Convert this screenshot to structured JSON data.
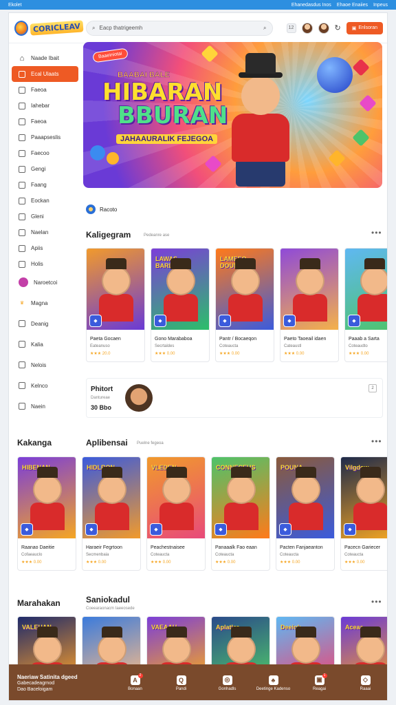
{
  "topbar": {
    "left": "Ekolet",
    "right": [
      "Ehanedasdus Inos",
      "Ehaoe Enaiies",
      "Inpeus"
    ]
  },
  "header": {
    "logo_text": "CORICLEAV",
    "search_placeholder": "Eacp thatrigeemh",
    "icon_box_label": "12",
    "login_label": "Enlsoran"
  },
  "sidebar": {
    "items": [
      {
        "label": "Naade Ibait",
        "icon": "home-icon"
      },
      {
        "label": "Ecal Ulaats",
        "icon": "grid-icon",
        "active": true
      },
      {
        "label": "Faeoa",
        "icon": "box-icon"
      },
      {
        "label": "Iahebar",
        "icon": "box-icon"
      },
      {
        "label": "Faeoa",
        "icon": "box-icon"
      },
      {
        "label": "Paaapseslis",
        "icon": "box-icon"
      },
      {
        "label": "Faecoo",
        "icon": "box-icon"
      },
      {
        "label": "Gengi",
        "icon": "box-icon"
      },
      {
        "label": "Faang",
        "icon": "box-icon"
      },
      {
        "label": "Eockan",
        "icon": "box-icon"
      },
      {
        "label": "Gleni",
        "icon": "box-icon"
      },
      {
        "label": "Naelan",
        "icon": "box-icon"
      },
      {
        "label": "Apiis",
        "icon": "box-icon"
      },
      {
        "label": "Holis",
        "icon": "box-icon"
      },
      {
        "label": "Naroetcoi",
        "icon": "circle-icon"
      },
      {
        "label": "Magna",
        "icon": "crown-icon"
      },
      {
        "label": "Deanig",
        "icon": "box-icon"
      },
      {
        "label": "Kalia",
        "icon": "box-icon"
      },
      {
        "label": "Nelois",
        "icon": "box-icon"
      },
      {
        "label": "Kelnco",
        "icon": "box-icon"
      },
      {
        "label": "Naein",
        "icon": "box-icon"
      }
    ]
  },
  "hero": {
    "tag": "Baaeiniotai",
    "small": "BAABAI BALE",
    "title_l1": "HIBARAN",
    "title_l2": "BBURAN",
    "subtitle": "JAHAAURALIK FEJEGOA"
  },
  "pill": {
    "label": "Racoto"
  },
  "section1": {
    "title": "Kaligegram",
    "sub": "Pedeanre  ase",
    "cards": [
      {
        "name": "Paeta Gocaen",
        "rating": "★★★  20.0",
        "sub": "Eateanuso",
        "bg": "#f19a2c",
        "bg2": "#6a3ad6",
        "tile": "",
        "wm": ""
      },
      {
        "name": "Gono Marababoa",
        "rating": "★★★  0.00",
        "sub": "Secrtaldes",
        "bg": "#7b3ed8",
        "bg2": "#2cbf6a",
        "tile": "",
        "wm": "LAWAS BARLAND"
      },
      {
        "name": "Pantr / Bocaeqon",
        "rating": "★★★  0.00",
        "sub": "Coteaucta",
        "bg": "#ff7a1a",
        "bg2": "#3b5bdc",
        "tile": "",
        "wm": "LAMEEO DOUNES"
      },
      {
        "name": "Paeto Taoeail idaen",
        "rating": "★★★  0.00",
        "sub": "Cateaustl",
        "bg": "#8f4ad8",
        "bg2": "#f4b14a",
        "tile": "",
        "wm": ""
      },
      {
        "name": "Paaab a Sarta",
        "rating": "★★★  0.00",
        "sub": "Coteaudto",
        "bg": "#5fb8f2",
        "bg2": "#4ec36a",
        "tile": "",
        "wm": ""
      }
    ]
  },
  "promo": {
    "title": "Phitort",
    "sub": "Dantureae",
    "value": "30 Bbo",
    "badge": "2"
  },
  "section2": {
    "left_title": "Kakanga",
    "title": "Aplibensai",
    "sub": "Puelne fegeoa",
    "cards": [
      {
        "name": "Raanao Daeitie",
        "rating": "★★★  0.00",
        "sub": "Cofaeauclo",
        "bg": "#7b3ed8",
        "bg2": "#f5a623",
        "tile": "",
        "wm": "HIBENAN"
      },
      {
        "name": "Haraeir Fegrtoon",
        "rating": "★★★  0.00",
        "sub": "Secmenbaia",
        "bg": "#3b5bdc",
        "bg2": "#f19a2c",
        "tile": "",
        "wm": "HIDLRON"
      },
      {
        "name": "Peachestnaisee",
        "rating": "★★★  0.00",
        "sub": "Coteaucta",
        "bg": "#f19a2c",
        "bg2": "#e84a7a",
        "tile": "",
        "wm": "VLEDEN"
      },
      {
        "name": "Panaaalk Fao eaan",
        "rating": "★★★  0.00",
        "sub": "Coteaucta",
        "bg": "#4ec36a",
        "bg2": "#ff7a1a",
        "tile": "",
        "wm": "CONNECEUS"
      },
      {
        "name": "Pacten Fanjaeanton",
        "rating": "★★★  0.00",
        "sub": "Coteaucta",
        "bg": "#8a5a3a",
        "bg2": "#3b5bdc",
        "tile": "",
        "wm": "POUNA"
      },
      {
        "name": "Pacecn Gariecer",
        "rating": "★★★  0.00",
        "sub": "Coteaucta",
        "bg": "#1e2a4a",
        "bg2": "#f5a623",
        "tile": "",
        "wm": "Vilgdow"
      }
    ]
  },
  "section3": {
    "left_title": "Marahakan",
    "title": "Saniokadul",
    "sub": "Coeearaonacm   Iaeeosede",
    "cards": [
      {
        "bg": "#1e2a6a",
        "bg2": "#f19a2c",
        "wm": "VALEHAN"
      },
      {
        "bg": "#3b7bdc",
        "bg2": "#f2b98a",
        "wm": ""
      },
      {
        "bg": "#7b3ed8",
        "bg2": "#f5a623",
        "wm": "VAEAAH"
      },
      {
        "bg": "#2a4a8a",
        "bg2": "#4ec36a",
        "wm": "Aplatler"
      },
      {
        "bg": "#5fb8f2",
        "bg2": "#e84a7a",
        "wm": "Deeiok"
      },
      {
        "bg": "#6a3ad6",
        "bg2": "#f19a2c",
        "wm": "Aceaa"
      }
    ]
  },
  "bottomnav": {
    "line1": "Naeriaw Satinita dgeed",
    "line2": "Gabecadeagrnod",
    "line3": "Dao Baceloigam",
    "items": [
      {
        "label": "Bonaan",
        "icon": "A",
        "badge": "2"
      },
      {
        "label": "Pandi",
        "icon": "Q"
      },
      {
        "label": "Gonhadls",
        "icon": "◎"
      },
      {
        "label": "Deetinge Kadenso",
        "icon": "♣"
      },
      {
        "label": "Reagai",
        "icon": "▣",
        "badge": "1"
      },
      {
        "label": "Raaai",
        "icon": "◇"
      }
    ]
  }
}
